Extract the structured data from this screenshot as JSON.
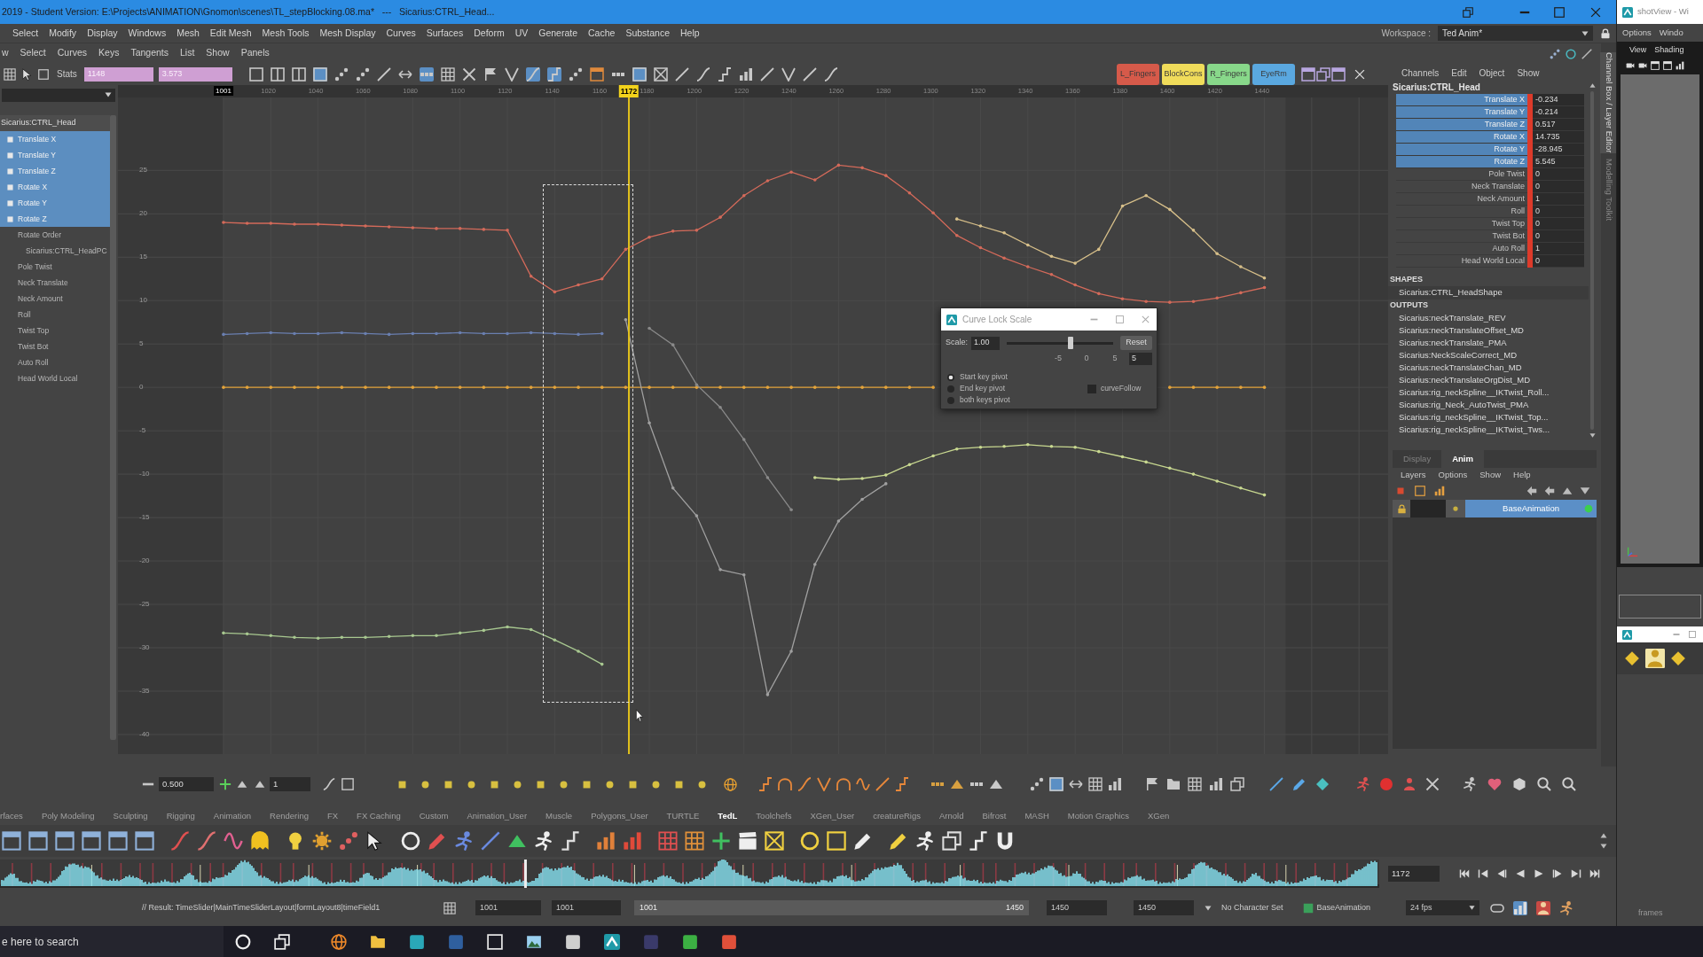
{
  "title_bar": {
    "title": "2019 - Student Version: E:\\Projects\\ANIMATION\\Gnomon\\scenes\\TL_stepBlocking.08.ma*   ---   Sicarius:CTRL_Head..."
  },
  "main_menu": {
    "items": [
      "Select",
      "Modify",
      "Display",
      "Windows",
      "Mesh",
      "Edit Mesh",
      "Mesh Tools",
      "Mesh Display",
      "Curves",
      "Surfaces",
      "Deform",
      "UV",
      "Generate",
      "Cache",
      "Substance",
      "Help"
    ],
    "workspace_label": "Workspace :",
    "workspace": "Ted Anim*"
  },
  "graph_editor": {
    "menu": [
      "w",
      "Select",
      "Curves",
      "Keys",
      "Tangents",
      "List",
      "Show",
      "Panels"
    ],
    "stats_label": "Stats",
    "stats_fields": [
      "1148",
      "3.573"
    ],
    "toolbar_buttons": [
      {
        "on": false
      },
      {
        "on": false
      },
      {
        "on": false
      },
      {
        "on": true
      },
      {
        "on": false
      },
      {
        "on": false
      },
      {
        "on": false
      },
      {
        "on": false
      },
      {
        "on": true
      },
      {
        "on": false
      },
      {
        "on": false
      },
      {
        "on": false
      },
      {
        "on": false
      },
      {
        "on": true
      },
      {
        "on": true
      },
      {
        "on": false
      },
      {
        "on": false
      },
      {
        "on": false
      },
      {
        "on": true
      },
      {
        "on": false
      },
      {
        "on": false
      },
      {
        "on": false
      },
      {
        "on": false
      },
      {
        "on": false
      },
      {
        "on": false
      },
      {
        "on": false
      },
      {
        "on": false
      },
      {
        "on": false
      }
    ],
    "quick_select": [
      {
        "label": "L_Fingers",
        "color": "#d65a4a"
      },
      {
        "label": "BlockCons",
        "color": "#f0dc5a"
      },
      {
        "label": "R_Fingers",
        "color": "#88d88a"
      },
      {
        "label": "EyeRm",
        "color": "#5aa8e0"
      }
    ],
    "time_ruler": {
      "current_frame": "1172"
    },
    "outliner": {
      "node": "Sicarius:CTRL_Head",
      "channels": [
        {
          "label": "Translate X",
          "selected": true
        },
        {
          "label": "Translate Y",
          "selected": true
        },
        {
          "label": "Translate Z",
          "selected": true
        },
        {
          "label": "Rotate X",
          "selected": true
        },
        {
          "label": "Rotate Y",
          "selected": true
        },
        {
          "label": "Rotate Z",
          "selected": true
        },
        {
          "label": "Rotate Order",
          "selected": false,
          "children": [
            {
              "label": "Sicarius:CTRL_HeadPC",
              "selected": false
            }
          ]
        },
        {
          "label": "Pole Twist",
          "selected": false
        },
        {
          "label": "Neck Translate",
          "selected": false
        },
        {
          "label": "Neck Amount",
          "selected": false
        },
        {
          "label": "Roll",
          "selected": false
        },
        {
          "label": "Twist Top",
          "selected": false
        },
        {
          "label": "Twist Bot",
          "selected": false
        },
        {
          "label": "Auto Roll",
          "selected": false
        },
        {
          "label": "Head World Local",
          "selected": false
        }
      ]
    },
    "chart_data": {
      "type": "line",
      "grid": true,
      "x": [
        1001,
        1011,
        1021,
        1031,
        1041,
        1051,
        1061,
        1071,
        1081,
        1091,
        1101,
        1111,
        1121,
        1131,
        1141,
        1151,
        1161,
        1171,
        1181,
        1191,
        1201,
        1211,
        1221,
        1231,
        1241,
        1251,
        1261,
        1271,
        1281,
        1291,
        1301,
        1311,
        1321,
        1331,
        1341,
        1351,
        1361,
        1371,
        1381,
        1391,
        1401,
        1411,
        1421,
        1431,
        1441
      ],
      "xlim": [
        956.4,
        1493.3
      ],
      "ylim": [
        -42.25,
        33.4
      ],
      "xticks": [
        {
          "value": 1001,
          "label": "1001"
        },
        {
          "value": 1020,
          "label": "1020"
        },
        {
          "value": 1040,
          "label": "1040"
        },
        {
          "value": 1060,
          "label": "1060"
        },
        {
          "value": 1080,
          "label": "1080"
        },
        {
          "value": 1100,
          "label": "1100"
        },
        {
          "value": 1120,
          "label": "1120"
        },
        {
          "value": 1140,
          "label": "1140"
        },
        {
          "value": 1160,
          "label": "1160"
        },
        {
          "value": 1180,
          "label": "1180"
        },
        {
          "value": 1200,
          "label": "1200"
        },
        {
          "value": 1220,
          "label": "1220"
        },
        {
          "value": 1240,
          "label": "1240"
        },
        {
          "value": 1260,
          "label": "1260"
        },
        {
          "value": 1280,
          "label": "1280"
        },
        {
          "value": 1300,
          "label": "1300"
        },
        {
          "value": 1320,
          "label": "1320"
        },
        {
          "value": 1340,
          "label": "1340"
        },
        {
          "value": 1360,
          "label": "1360"
        },
        {
          "value": 1380,
          "label": "1380"
        },
        {
          "value": 1400,
          "label": "1400"
        },
        {
          "value": 1420,
          "label": "1420"
        },
        {
          "value": 1440,
          "label": "1440"
        }
      ],
      "yticks": [
        {
          "value": 25,
          "label": "25"
        },
        {
          "value": 20,
          "label": "20"
        },
        {
          "value": 15,
          "label": "15"
        },
        {
          "value": 10,
          "label": "10"
        },
        {
          "value": 5,
          "label": "5"
        },
        {
          "value": 0,
          "label": "0"
        },
        {
          "value": -5,
          "label": "-5"
        },
        {
          "value": -10,
          "label": "-10"
        },
        {
          "value": -15,
          "label": "-15"
        },
        {
          "value": -20,
          "label": "-20"
        },
        {
          "value": -25,
          "label": "-25"
        },
        {
          "value": -30,
          "label": "-30"
        },
        {
          "value": -35,
          "label": "-35"
        },
        {
          "value": -40,
          "label": "-40"
        }
      ],
      "bands": [
        {
          "axis": "x",
          "from": 1001,
          "to": 1450,
          "color": "#414141"
        }
      ],
      "ref_lines": [
        {
          "axis": "x",
          "value": 1172,
          "color": "#e3c21c"
        }
      ],
      "series": [
        {
          "color": "#d46a5a",
          "values": [
            19,
            18.9,
            18.9,
            18.8,
            18.8,
            18.7,
            18.6,
            18.5,
            18.4,
            18.3,
            18.3,
            18.2,
            18.1,
            12.8,
            11,
            11.8,
            12.5,
            15.9,
            17.3,
            18,
            18.1,
            19.6,
            22.1,
            23.8,
            24.8,
            23.9,
            25.6,
            25.3,
            24.4,
            22.4,
            20.1,
            17.5,
            16.1,
            14.9,
            13.9,
            13,
            11.8,
            10.8,
            10.2,
            9.9,
            9.8,
            9.9,
            10.3,
            10.9,
            11.5
          ]
        },
        {
          "color": "#d8c08a",
          "values": [
            null,
            null,
            null,
            null,
            null,
            null,
            null,
            null,
            null,
            null,
            null,
            null,
            null,
            null,
            null,
            null,
            null,
            null,
            null,
            null,
            null,
            null,
            null,
            null,
            null,
            null,
            null,
            null,
            null,
            null,
            null,
            19.4,
            18.6,
            17.8,
            16.4,
            15.1,
            14.3,
            15.9,
            20.9,
            22.1,
            20.5,
            18.1,
            15.4,
            13.9,
            12.6
          ]
        },
        {
          "color": "#e3a33a",
          "values": [
            0,
            0,
            0,
            0,
            0,
            0,
            0,
            0,
            0,
            0,
            0,
            0,
            0,
            0,
            0,
            0,
            0,
            0,
            0,
            0,
            0,
            0,
            0,
            0,
            0,
            0,
            0,
            0,
            0,
            0,
            0,
            null,
            null,
            null,
            null,
            null,
            null,
            null,
            null,
            null,
            0,
            0,
            0,
            0,
            0
          ]
        },
        {
          "color": "#6a7fb0",
          "values": [
            6.1,
            6.2,
            6.3,
            6.2,
            6.2,
            6.3,
            6.2,
            6.1,
            6.2,
            6.2,
            6.3,
            6.2,
            6.2,
            6.3,
            6.2,
            6.1,
            6.2,
            null,
            null,
            null,
            null,
            null,
            null,
            null,
            null,
            null,
            null,
            null,
            null,
            null,
            null,
            null,
            null,
            null,
            null,
            null,
            null,
            null,
            null,
            null,
            null,
            null,
            null,
            null,
            null
          ]
        },
        {
          "color": "#a8c890",
          "values": [
            -28.3,
            -28.4,
            -28.6,
            -28.8,
            -28.9,
            -28.8,
            -28.8,
            -28.7,
            -28.6,
            -28.6,
            -28.3,
            -28,
            -27.6,
            -27.9,
            -29.1,
            -30.4,
            -31.9,
            null,
            null,
            null,
            null,
            null,
            null,
            null,
            null,
            null,
            null,
            null,
            null,
            null,
            null,
            null,
            null,
            null,
            null,
            null,
            null,
            null,
            null,
            null,
            null,
            null,
            null,
            null,
            null
          ]
        },
        {
          "color": "#a0a0a0",
          "values": [
            null,
            null,
            null,
            null,
            null,
            null,
            null,
            null,
            null,
            null,
            null,
            null,
            null,
            null,
            null,
            null,
            null,
            7.8,
            -4.1,
            -11.6,
            -14.8,
            -21,
            -21.6,
            -35.4,
            -30.4,
            -20.4,
            -15.4,
            -12.9,
            -11.1,
            null,
            null,
            null,
            null,
            null,
            null,
            null,
            null,
            null,
            null,
            null,
            null,
            null,
            null,
            null,
            null
          ]
        },
        {
          "color": "#c8d890",
          "values": [
            null,
            null,
            null,
            null,
            null,
            null,
            null,
            null,
            null,
            null,
            null,
            null,
            null,
            null,
            null,
            null,
            null,
            null,
            null,
            null,
            null,
            null,
            null,
            null,
            null,
            -10.4,
            -10.6,
            -10.5,
            -10.1,
            -8.9,
            -7.9,
            -7.1,
            -6.9,
            -6.8,
            -6.6,
            -6.8,
            -6.9,
            -7.4,
            -8,
            -8.6,
            -9.3,
            -10,
            -10.8,
            -11.6,
            -12.4
          ]
        },
        {
          "color": "#8a8a8a",
          "values": [
            null,
            null,
            null,
            null,
            null,
            null,
            null,
            null,
            null,
            null,
            null,
            null,
            null,
            null,
            null,
            null,
            null,
            null,
            6.8,
            4.9,
            0.3,
            -2.3,
            -6,
            -10.4,
            -14.1,
            null,
            null,
            null,
            null,
            null,
            null,
            null,
            null,
            null,
            null,
            null,
            null,
            null,
            null,
            null,
            null,
            null,
            null,
            null,
            null
          ]
        }
      ]
    },
    "curve_lock_scale": {
      "title": "Curve Lock Scale",
      "scale_label": "Scale:",
      "scale_value": "1.00",
      "level": 0.6,
      "reset": "Reset",
      "ticks": [
        "-5",
        "0",
        "5"
      ],
      "range_value": "5",
      "pivots": [
        {
          "label": "Start key pivot",
          "selected": true
        },
        {
          "label": "End key pivot",
          "selected": false
        },
        {
          "label": "both keys pivot",
          "selected": false
        }
      ],
      "curve_follow": {
        "label": "curveFollow",
        "checked": false
      }
    },
    "bottom_toolbar": {
      "step": "0.500",
      "value": "1",
      "buttons": [
        {
          "on": false
        },
        {
          "on": false
        },
        {
          "on": false
        },
        {
          "on": false
        },
        {
          "on": false
        },
        {
          "on": false
        },
        {
          "on": false
        },
        {
          "on": false
        },
        {
          "on": false
        },
        {
          "on": false
        },
        {
          "on": false
        },
        {
          "on": false
        },
        {
          "on": false
        },
        {
          "on": false
        },
        {
          "on": false
        },
        {
          "on": false
        },
        {
          "on": false
        },
        {
          "on": false
        },
        {
          "on": false
        },
        {
          "on": false
        },
        {
          "on": false
        },
        {
          "on": false
        },
        {
          "on": false
        },
        {
          "on": false
        },
        {
          "on": false
        },
        {
          "on": false
        },
        {
          "on": false
        },
        {
          "on": false
        },
        {
          "on": false
        },
        {
          "on": false
        },
        {
          "on": true
        },
        {
          "on": false
        },
        {
          "on": false
        },
        {
          "on": false
        },
        {
          "on": false
        },
        {
          "on": false
        },
        {
          "on": false
        },
        {
          "on": false
        },
        {
          "on": false
        },
        {
          "on": false
        },
        {
          "on": false
        },
        {
          "on": false
        },
        {
          "on": false
        },
        {
          "on": false
        },
        {
          "on": false
        },
        {
          "on": false
        },
        {
          "on": false
        },
        {
          "on": false
        },
        {
          "on": false
        },
        {
          "on": false
        },
        {
          "on": false
        }
      ]
    }
  },
  "channel_box": {
    "menu": [
      "Channels",
      "Edit",
      "Object",
      "Show"
    ],
    "node": "Sicarius:CTRL_Head",
    "attributes": [
      {
        "name": "Translate X",
        "value": "-0.234",
        "selected": true,
        "keyed": true
      },
      {
        "name": "Translate Y",
        "value": "-0.214",
        "selected": true,
        "keyed": true
      },
      {
        "name": "Translate Z",
        "value": "0.517",
        "selected": true,
        "keyed": true
      },
      {
        "name": "Rotate X",
        "value": "14.735",
        "selected": true,
        "keyed": true
      },
      {
        "name": "Rotate Y",
        "value": "-28.945",
        "selected": true,
        "keyed": true
      },
      {
        "name": "Rotate Z",
        "value": "5.545",
        "selected": true,
        "keyed": true
      },
      {
        "name": "Pole Twist",
        "value": "0",
        "selected": false,
        "keyed": true
      },
      {
        "name": "Neck Translate",
        "value": "0",
        "selected": false,
        "keyed": true
      },
      {
        "name": "Neck Amount",
        "value": "1",
        "selected": false,
        "keyed": true
      },
      {
        "name": "Roll",
        "value": "0",
        "selected": false,
        "keyed": true
      },
      {
        "name": "Twist Top",
        "value": "0",
        "selected": false,
        "keyed": true
      },
      {
        "name": "Twist Bot",
        "value": "0",
        "selected": false,
        "keyed": true
      },
      {
        "name": "Auto Roll",
        "value": "1",
        "selected": false,
        "keyed": true
      },
      {
        "name": "Head World Local",
        "value": "0",
        "selected": false,
        "keyed": true
      }
    ],
    "shapes_heading": "SHAPES",
    "shapes": [
      "Sicarius:CTRL_HeadShape"
    ],
    "outputs_heading": "OUTPUTS",
    "outputs": [
      "Sicarius:neckTranslate_REV",
      "Sicarius:neckTranslateOffset_MD",
      "Sicarius:neckTranslate_PMA",
      "Sicarius:NeckScaleCorrect_MD",
      "Sicarius:neckTranslateChan_MD",
      "Sicarius:neckTranslateOrgDist_MD",
      "Sicarius:rig_neckSpline__IKTwist_Roll...",
      "Sicarius:rig_Neck_AutoTwist_PMA",
      "Sicarius:rig_neckSpline__IKTwist_Top...",
      "Sicarius:rig_neckSpline__IKTwist_Tws..."
    ]
  },
  "side_tabs": [
    {
      "label": "Channel Box / Layer Editor",
      "selected": true
    },
    {
      "label": "Modelling Toolkit",
      "selected": false
    }
  ],
  "layer_editor": {
    "tabs": [
      {
        "label": "Display",
        "selected": false
      },
      {
        "label": "Anim",
        "selected": true
      }
    ],
    "menu": [
      "Layers",
      "Options",
      "Show",
      "Help"
    ],
    "layers": [
      {
        "name": "BaseAnimation",
        "selected": true
      }
    ]
  },
  "shelf": {
    "tabs": [
      {
        "label": "rfaces",
        "selected": false
      },
      {
        "label": "Poly Modeling",
        "selected": false
      },
      {
        "label": "Sculpting",
        "selected": false
      },
      {
        "label": "Rigging",
        "selected": false
      },
      {
        "label": "Animation",
        "selected": false
      },
      {
        "label": "Rendering",
        "selected": false
      },
      {
        "label": "FX",
        "selected": false
      },
      {
        "label": "FX Caching",
        "selected": false
      },
      {
        "label": "Custom",
        "selected": false
      },
      {
        "label": "Animation_User",
        "selected": false
      },
      {
        "label": "Muscle",
        "selected": false
      },
      {
        "label": "Polygons_User",
        "selected": false
      },
      {
        "label": "TURTLE",
        "selected": false
      },
      {
        "label": "TedL",
        "selected": true
      },
      {
        "label": "Toolchefs",
        "selected": false
      },
      {
        "label": "XGen_User",
        "selected": false
      },
      {
        "label": "creatureRigs",
        "selected": false
      },
      {
        "label": "Arnold",
        "selected": false
      },
      {
        "label": "Bifrost",
        "selected": false
      },
      {
        "label": "MASH",
        "selected": false
      },
      {
        "label": "Motion Graphics",
        "selected": false
      },
      {
        "label": "XGen",
        "selected": false
      }
    ]
  },
  "time_slider": {
    "current_frame": "1172",
    "level": 0.381
  },
  "range_slider": {
    "result": "// Result: TimeSlider|MainTimeSliderLayout|formLayout8|timeField1",
    "start_fields": [
      "1001",
      "1001"
    ],
    "range_start": "1001",
    "range_end": "1450",
    "end_fields": [
      "1450",
      "1450"
    ],
    "character_set": "No Character Set",
    "anim_layer": "BaseAnimation",
    "fps": "24 fps",
    "buttons": [
      {
        "on": false
      },
      {
        "on": true
      },
      {
        "on": true
      },
      {
        "on": false
      }
    ]
  },
  "shot_view": {
    "title": "shotView - Wi",
    "menu": [
      "Options",
      "Windo"
    ],
    "panel_menu": [
      "View",
      "Shading"
    ],
    "frames_label": "frames"
  },
  "taskbar": {
    "search_placeholder": "e here to search"
  }
}
